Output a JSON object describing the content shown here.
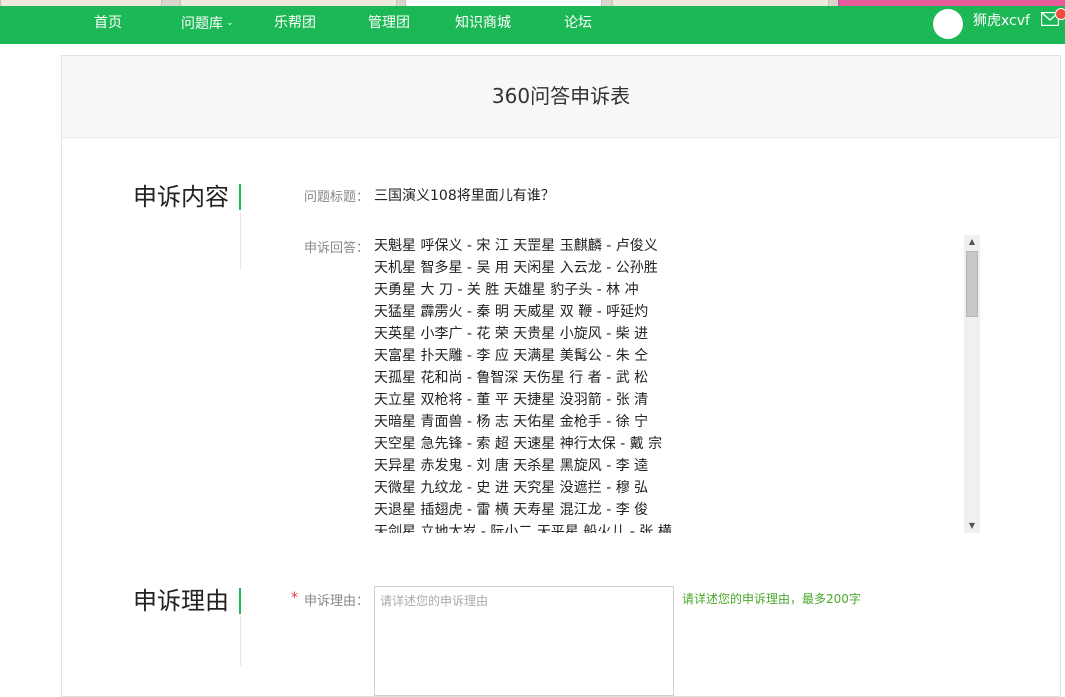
{
  "nav": {
    "items": [
      {
        "label": "首页"
      },
      {
        "label": "问题库",
        "has_dropdown": true
      },
      {
        "label": "乐帮团"
      },
      {
        "label": "管理团"
      },
      {
        "label": "知识商城"
      },
      {
        "label": "论坛"
      }
    ],
    "username": "狮虎xcvf",
    "mail_icon": "mail-icon"
  },
  "page": {
    "title": "360问答申诉表"
  },
  "appeal_content": {
    "section_title": "申诉内容",
    "question_label": "问题标题：",
    "question_value": "三国演义108将里面儿有谁？",
    "answer_label": "申诉回答：",
    "answer_lines": [
      "天魁星 呼保义 - 宋 江 天罡星 玉麒麟 - 卢俊义",
      "天机星 智多星 - 吴 用 天闲星 入云龙 - 公孙胜",
      "天勇星 大 刀 - 关 胜 天雄星 豹子头 - 林 冲",
      "天猛星 霹雳火 - 秦 明 天威星 双 鞭 - 呼延灼",
      "天英星 小李广 - 花 荣 天贵星 小旋风 - 柴 进",
      "天富星 扑天雕 - 李 应 天满星 美髯公 - 朱 仝",
      "天孤星 花和尚 - 鲁智深 天伤星 行 者 - 武 松",
      "天立星 双枪将 - 董 平 天捷星 没羽箭 - 张 清",
      "天暗星 青面兽 - 杨 志 天佑星 金枪手 - 徐 宁",
      "天空星 急先锋 - 索 超 天速星 神行太保 - 戴 宗",
      "天异星 赤发鬼 - 刘 唐 天杀星 黑旋风 - 李 逵",
      "天微星 九纹龙 - 史 进 天究星 没遮拦 - 穆 弘",
      "天退星 插翅虎 - 雷 横 天寿星 混江龙 - 李 俊",
      "天剑星 立地太岁 - 阮小二 天平星 船火儿 - 张 横"
    ]
  },
  "appeal_reason": {
    "section_title": "申诉理由",
    "required_mark": "*",
    "label": "申诉理由：",
    "placeholder": "请详述您的申诉理由",
    "hint": "请详述您的申诉理由，最多200字"
  },
  "colors": {
    "brand_green": "#1cb855",
    "hint_green": "#4aa82a",
    "required_red": "#e4393c"
  }
}
